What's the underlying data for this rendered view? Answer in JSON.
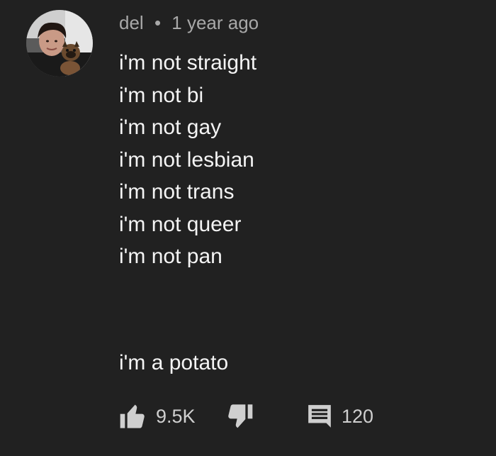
{
  "comment": {
    "author": "del",
    "separator": "•",
    "time": "1 year ago",
    "lines": [
      "i'm not straight",
      "i'm not bi",
      "i'm not gay",
      "i'm not lesbian",
      "i'm not trans",
      "i'm not queer",
      "i'm not pan"
    ],
    "punchline": "i'm a potato",
    "likes": "9.5K",
    "replies": "120"
  },
  "icons": {
    "like": "thumbs-up-icon",
    "dislike": "thumbs-down-icon",
    "reply": "comment-icon"
  },
  "colors": {
    "background": "#212121",
    "text": "#f4f4f4",
    "meta": "#a8a8a8",
    "icon": "#cfcfcf"
  }
}
